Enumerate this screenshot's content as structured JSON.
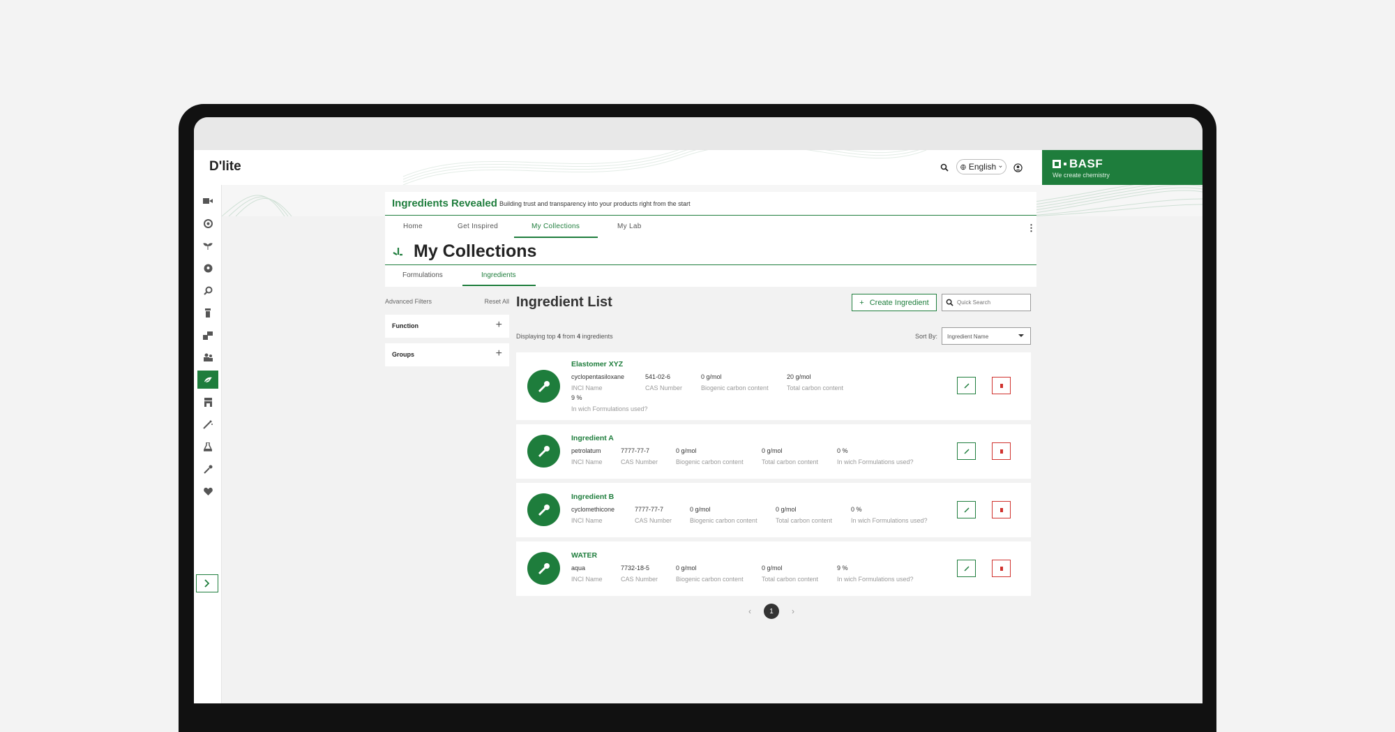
{
  "app": {
    "title": "D'lite"
  },
  "header": {
    "language": "English"
  },
  "brand": {
    "logo": "BASF",
    "tagline": "We create chemistry"
  },
  "banner": {
    "title": "Ingredients Revealed",
    "subtitle": "Building trust and transparency into your products right from the start"
  },
  "nav": {
    "tabs": [
      "Home",
      "Get Inspired",
      "My Collections",
      "My Lab"
    ],
    "active": "My Collections"
  },
  "page": {
    "title": "My Collections"
  },
  "subtabs": {
    "items": [
      "Formulations",
      "Ingredients"
    ],
    "active": "Ingredients"
  },
  "filters": {
    "title": "Advanced Filters",
    "reset": "Reset All",
    "groups": [
      "Function",
      "Groups"
    ]
  },
  "list": {
    "title": "Ingredient List",
    "create_label": "Create Ingredient",
    "search_placeholder": "Quick Search",
    "displaying_prefix": "Displaying top",
    "displaying_count": "4",
    "displaying_mid": "from",
    "displaying_total": "4",
    "displaying_suffix": "ingredients",
    "sort_label": "Sort By:",
    "sort_value": "Ingredient Name"
  },
  "field_labels": {
    "inci": "INCI Name",
    "cas": "CAS Number",
    "biogenic": "Biogenic carbon content",
    "total": "Total carbon content",
    "used": "In wich Formulations used?"
  },
  "ingredients": [
    {
      "name": "Elastomer XYZ",
      "inci": "cyclopentasiloxane",
      "cas": "541-02-6",
      "biogenic": "0 g/mol",
      "total": "20 g/mol",
      "used": "9 %"
    },
    {
      "name": "Ingredient A",
      "inci": "petrolatum",
      "cas": "7777-77-7",
      "biogenic": "0 g/mol",
      "total": "0 g/mol",
      "used": "0 %"
    },
    {
      "name": "Ingredient B",
      "inci": "cyclomethicone",
      "cas": "7777-77-7",
      "biogenic": "0 g/mol",
      "total": "0 g/mol",
      "used": "0 %"
    },
    {
      "name": "WATER",
      "inci": "aqua",
      "cas": "7732-18-5",
      "biogenic": "0 g/mol",
      "total": "0 g/mol",
      "used": "9 %"
    }
  ],
  "pagination": {
    "current": "1",
    "prev": "‹",
    "next": "›"
  },
  "colors": {
    "accent": "#1e7d3c",
    "danger": "#d0322e",
    "background": "#f2f2f2"
  },
  "sidebar": {
    "icons": [
      "video-icon",
      "target-icon",
      "plant-icon",
      "globe-icon",
      "analysis-icon",
      "tube-icon",
      "chart-icon",
      "team-icon",
      "collection-icon",
      "store-icon",
      "magic-icon",
      "flask-icon",
      "dropper-icon",
      "heart-icon",
      "expand-icon"
    ],
    "active": "collection-icon"
  }
}
